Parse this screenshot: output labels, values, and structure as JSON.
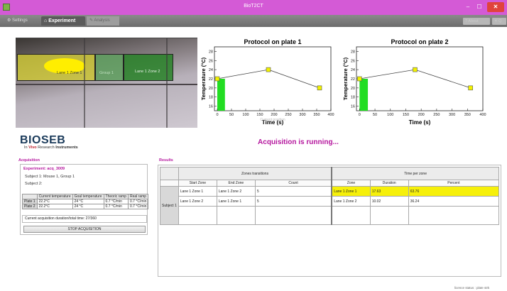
{
  "window": {
    "title": "BioT2CT",
    "minimize_label": "–",
    "maximize_label": "☐",
    "close_label": "✕"
  },
  "tabs": {
    "settings": "Settings",
    "experiment": "Experiment",
    "analysis": "Analysis",
    "about": "About",
    "quit": "Q"
  },
  "video": {
    "zone_labels": [
      "Lane 1 Zone 1",
      "Group 1",
      "Lane 1 Zone 2"
    ],
    "zone_colors": [
      "#d4cd32",
      "#5fa05f",
      "#288228"
    ],
    "animal_color": "#ffee00"
  },
  "charts": [
    {
      "title": "Protocol on plate 1",
      "xlabel": "Time (s)",
      "ylabel": "Temperature (°C)",
      "overlay": "Current position"
    },
    {
      "title": "Protocol on plate 2",
      "xlabel": "Time (s)",
      "ylabel": "Temperature (°C)",
      "overlay": ""
    }
  ],
  "chart_data": [
    {
      "type": "line",
      "title": "Protocol on plate 1",
      "xlabel": "Time (s)",
      "ylabel": "Temperature (°C)",
      "x": [
        0,
        180,
        360
      ],
      "y": [
        22,
        24,
        20
      ],
      "xlim": [
        -10,
        400
      ],
      "ylim": [
        15,
        29
      ],
      "xticks": [
        0,
        50,
        100,
        150,
        200,
        250,
        300,
        350,
        400
      ],
      "yticks": [
        16,
        18,
        20,
        22,
        24,
        26,
        28
      ],
      "progress": {
        "x_start": 0,
        "x_end": 27,
        "color": "#22dd22"
      },
      "marker_color": "#f2f200"
    },
    {
      "type": "line",
      "title": "Protocol on plate 2",
      "xlabel": "Time (s)",
      "ylabel": "Temperature (°C)",
      "x": [
        0,
        180,
        360
      ],
      "y": [
        22,
        24,
        20
      ],
      "xlim": [
        -10,
        400
      ],
      "ylim": [
        15,
        29
      ],
      "xticks": [
        0,
        50,
        100,
        150,
        200,
        250,
        300,
        350,
        400
      ],
      "yticks": [
        16,
        18,
        20,
        22,
        24,
        26,
        28
      ],
      "progress": {
        "x_start": 0,
        "x_end": 27,
        "color": "#22dd22"
      },
      "marker_color": "#f2f200"
    }
  ],
  "logo": {
    "main": "BIOSEB",
    "sub_prefix": "In ",
    "sub_vivo": "Vivo",
    "sub_mid": " Research ",
    "sub_bold": "Instruments"
  },
  "status": {
    "running": "Acquisition is running..."
  },
  "acquisition": {
    "panel_title": "Acquisition",
    "experiment": "Experiment: acq_3009",
    "subject1": "Subject 1:  Mouse 1, Group 1",
    "subject2": "Subject 2:",
    "table_headers": [
      "",
      "Current temperature",
      "Goal temperature",
      "Theoric ramp",
      "Real ramp"
    ],
    "rows": [
      [
        "Plate 1",
        "22.2°C",
        "24 °C",
        "0.7 °C/min",
        "0.7 °C/min"
      ],
      [
        "Plate 2",
        "22.2°C",
        "24 °C",
        "0.7 °C/min",
        "0.7 °C/min"
      ]
    ],
    "duration": "Current acquisition duration/total time:  27/360",
    "stop_button": "STOP ACQUISITION"
  },
  "results": {
    "panel_title": "Results",
    "group_headers": [
      "Zones transitions",
      "Time per zone"
    ],
    "sub_headers": [
      "Start Zone",
      "End Zone",
      "Count",
      "Zone",
      "Duration",
      "Percent"
    ],
    "subject_label": "Subject 1",
    "rows": [
      [
        "Lane 1 Zone 1",
        "Lane 1 Zone 2",
        "5",
        "Lane 1 Zone 1",
        "17.63",
        "63.76"
      ],
      [
        "Lane 1 Zone 2",
        "Lane 1 Zone 1",
        "5",
        "Lane 1 Zone 2",
        "10.02",
        "36.24"
      ]
    ],
    "highlight_color": "#f6f00a"
  },
  "footer": {
    "licence": "licence status : plate strk"
  }
}
